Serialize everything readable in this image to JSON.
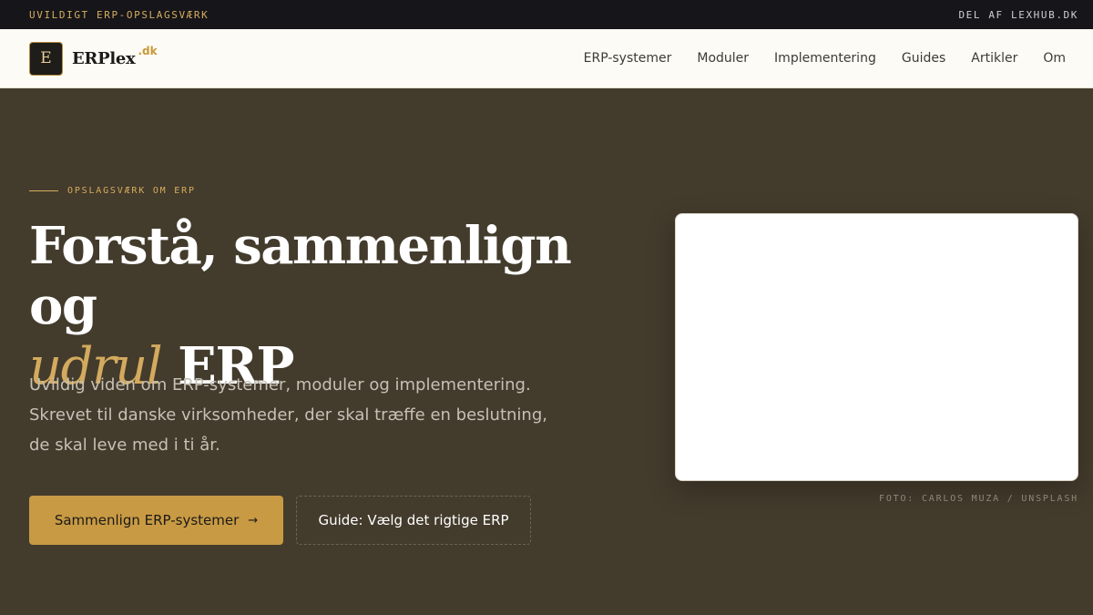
{
  "topbar": {
    "left_text": "UVILDIGT ERP-OPSLAGSVÆRK",
    "right_text": "DEL AF LEXHUB.DK"
  },
  "brand": {
    "logo_letter": "E",
    "name": "ERPlex",
    "tld": ".dk"
  },
  "nav": {
    "items": [
      "ERP-systemer",
      "Moduler",
      "Implementering",
      "Guides",
      "Artikler",
      "Om"
    ]
  },
  "hero": {
    "eyebrow": "OPSLAGSVÆRK OM ERP",
    "headline_line1": "Forstå, sammenlign og",
    "headline_accent": "udrul",
    "headline_end": " ERP",
    "lede": "Uvildig viden om ERP-systemer, moduler og implementering. Skrevet til danske virksomheder, der skal træffe en beslutning, de skal leve med i ti år.",
    "primary_cta": "Sammenlign ERP-systemer",
    "primary_cta_arrow": "→",
    "secondary_cta": "Guide: Vælg det rigtige ERP",
    "photo_credit": "FOTO: CARLOS MUZA / UNSPLASH"
  },
  "colors": {
    "accent": "#c89a44",
    "hero_bg": "#433b2c",
    "topbar_bg": "#16161a"
  }
}
